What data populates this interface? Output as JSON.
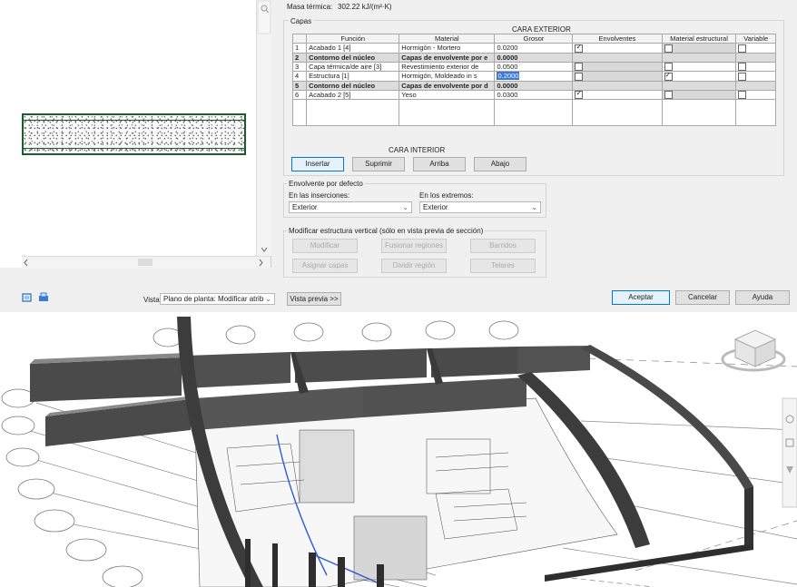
{
  "header": {
    "thermal_mass_label": "Masa térmica:",
    "thermal_mass_value": "302.22 kJ/(m²·K)"
  },
  "layers_section": {
    "label": "Capas",
    "exterior_side": "CARA EXTERIOR",
    "interior_side": "CARA INTERIOR",
    "columns": [
      "Función",
      "Material",
      "Grosor",
      "Envolventes",
      "Material estructural",
      "Variable"
    ],
    "rows": [
      {
        "num": "1",
        "function": "Acabado 1 [4]",
        "material": "Hormigón - Mortero",
        "thickness": "0.0200",
        "wraps": true,
        "structural": false,
        "variable": false,
        "kind": "normal"
      },
      {
        "num": "2",
        "function": "Contorno del núcleo",
        "material": "Capas de envolvente por e",
        "thickness": "0.0000",
        "kind": "core"
      },
      {
        "num": "3",
        "function": "Capa térmica/de aire [3]",
        "material": "Revestimiento exterior de",
        "thickness": "0.0500",
        "wraps": false,
        "structural": false,
        "variable": false,
        "kind": "normal"
      },
      {
        "num": "4",
        "function": "Estructura [1]",
        "material": "Hormigón, Moldeado in s",
        "thickness": "0.2000",
        "wraps": false,
        "structural": true,
        "variable": false,
        "kind": "selected"
      },
      {
        "num": "5",
        "function": "Contorno del núcleo",
        "material": "Capas de envolvente por d",
        "thickness": "0.0000",
        "kind": "core"
      },
      {
        "num": "6",
        "function": "Acabado 2 [5]",
        "material": "Yeso",
        "thickness": "0.0300",
        "wraps": true,
        "structural": false,
        "variable": false,
        "kind": "normal"
      }
    ]
  },
  "layer_buttons": {
    "insert": "Insertar",
    "delete": "Suprimir",
    "up": "Arriba",
    "down": "Abajo"
  },
  "default_wrapping": {
    "label": "Envolvente por defecto",
    "at_inserts_label": "En las inserciones:",
    "at_inserts_value": "Exterior",
    "at_ends_label": "En los extremos:",
    "at_ends_value": "Exterior"
  },
  "vertical_structure": {
    "label": "Modificar estructura vertical (sólo en vista previa de sección)",
    "modify": "Modificar",
    "merge_regions": "Fusionar regiones",
    "sweeps": "Barridos",
    "assign_layers": "Asignar capas",
    "split_region": "Dividir región",
    "reveals": "Telares"
  },
  "footer": {
    "view_label": "Vista:",
    "view_value": "Plano de planta: Modificar atrib",
    "preview_button": "Vista previa >>",
    "ok": "Aceptar",
    "cancel": "Cancelar",
    "help": "Ayuda"
  },
  "icons": {
    "zoom": "zoom-icon",
    "viewcube": "viewcube-icon"
  },
  "colors": {
    "wall_outline": "#1c5c2e",
    "selection": "#3a78d8",
    "wall_fill": "#4a4a4a"
  }
}
